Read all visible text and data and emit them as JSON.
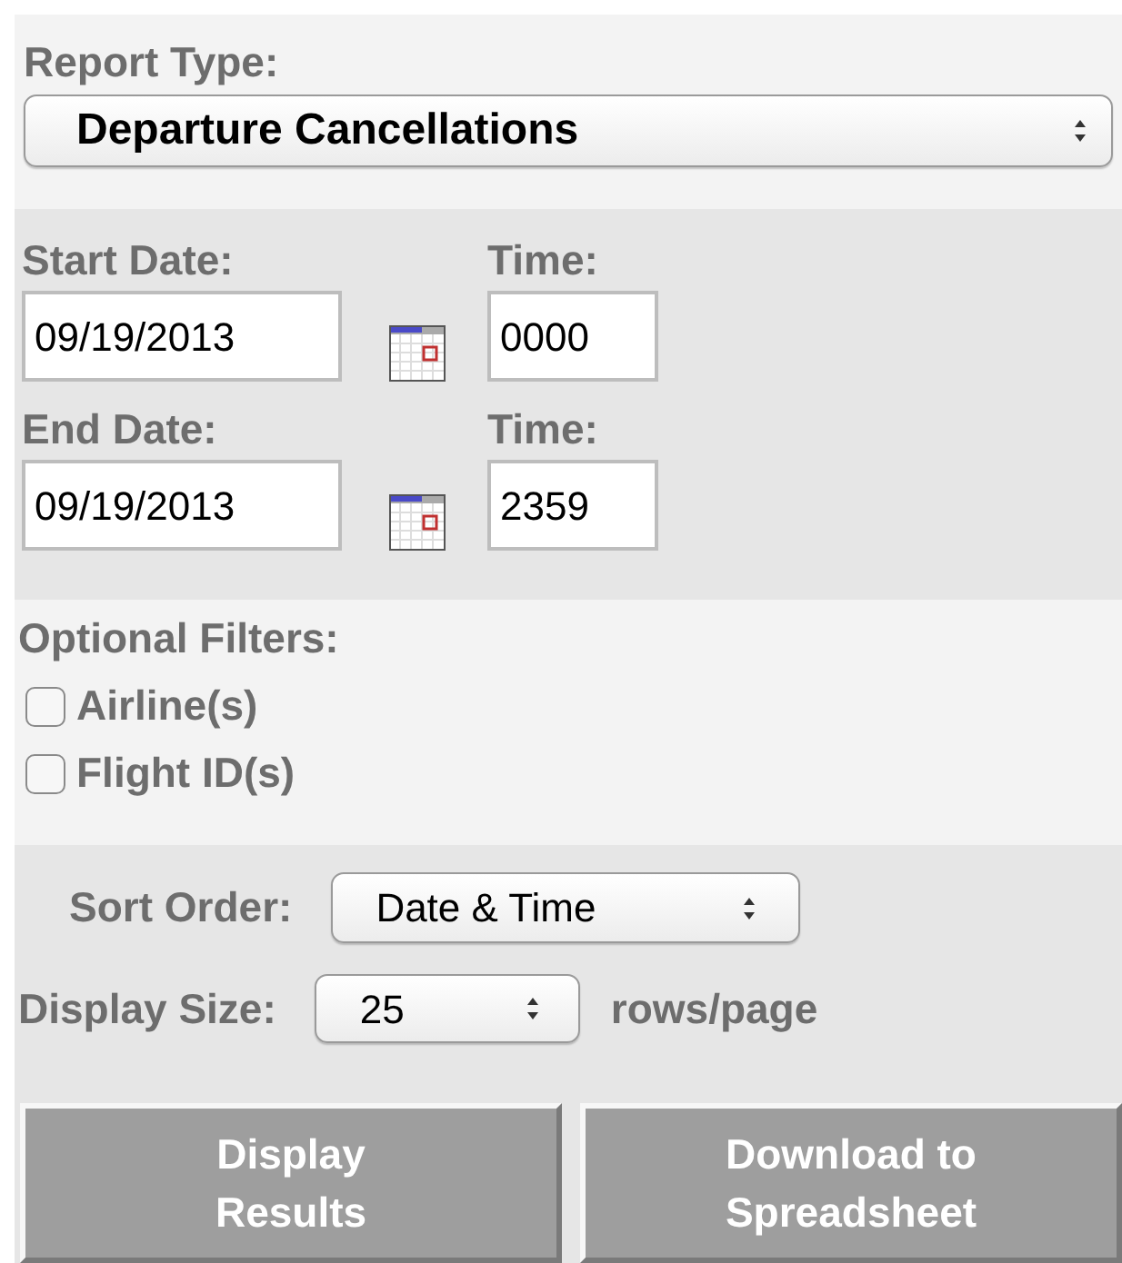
{
  "report_type": {
    "label": "Report Type:",
    "value": "Departure Cancellations"
  },
  "start": {
    "date_label": "Start Date:",
    "date": "09/19/2013",
    "time_label": "Time:",
    "time": "0000"
  },
  "end": {
    "date_label": "End Date:",
    "date": "09/19/2013",
    "time_label": "Time:",
    "time": "2359"
  },
  "optional_filters": {
    "label": "Optional Filters:",
    "options": [
      {
        "label": "Airline(s)",
        "checked": false
      },
      {
        "label": "Flight ID(s)",
        "checked": false
      }
    ]
  },
  "sort_order": {
    "label": "Sort Order:",
    "value": "Date & Time"
  },
  "display_size": {
    "label": "Display Size:",
    "value": "25",
    "unit": "rows/page"
  },
  "buttons": [
    "Display\nResults",
    "Download to\nSpreadsheet"
  ]
}
